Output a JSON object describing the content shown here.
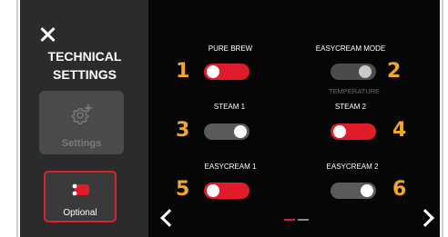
{
  "sidebar": {
    "title_line1": "TECHNICAL",
    "title_line2": "SETTINGS",
    "settings_tile_label": "Settings",
    "optional_tile_label": "Optional"
  },
  "settings": [
    {
      "number": "1",
      "label": "PURE BREW",
      "state": "on"
    },
    {
      "number": "2",
      "label": "EASYCREAM MODE",
      "state": "disabled",
      "sub_label": "TEMPERATURE"
    },
    {
      "number": "3",
      "label": "STEAM 1",
      "state": "off"
    },
    {
      "number": "4",
      "label": "STEAM 2",
      "state": "on"
    },
    {
      "number": "5",
      "label": "EASYCREAM 1",
      "state": "on"
    },
    {
      "number": "6",
      "label": "EASYCREAM 2",
      "state": "off"
    }
  ],
  "pagination": {
    "current_page": 1,
    "total_pages": 2
  },
  "colors": {
    "accent_red": "#e01b2a",
    "number_orange": "#f1a62e",
    "toggle_off": "#5a5a5a",
    "sidebar_bg": "#2b2b2b",
    "main_bg": "#060606"
  },
  "icons": {
    "close": "close-icon",
    "settings": "gear-icon",
    "optional": "toggle-switch-icon",
    "prev": "chevron-left-icon",
    "next": "chevron-right-icon"
  }
}
